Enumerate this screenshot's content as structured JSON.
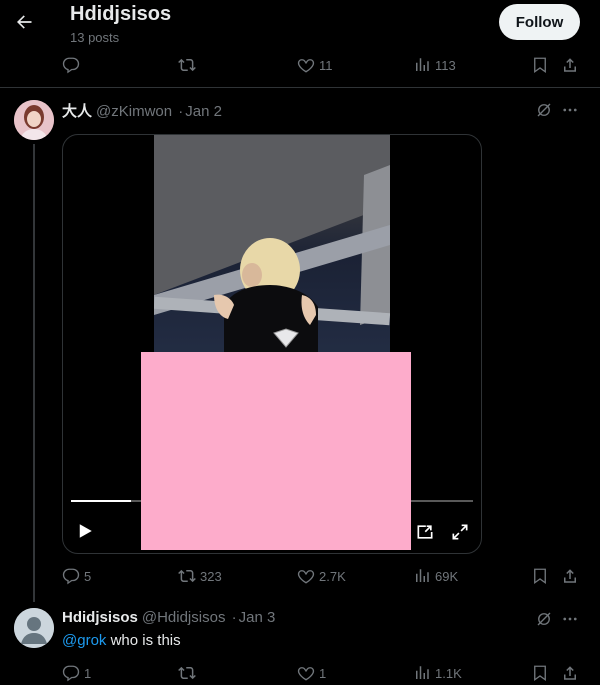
{
  "header": {
    "title": "Hdidjsisos",
    "subtitle": "13 posts",
    "follow_label": "Follow",
    "back_icon": "arrow-left-icon"
  },
  "top_actions": {
    "reply_count": "",
    "retweet_count": "",
    "like_count": "11",
    "views_count": "113"
  },
  "tweet1": {
    "name": "大人",
    "handle": "@zKimwon",
    "dot": "·",
    "date": "Jan 2",
    "media": {
      "type": "video",
      "progress": 0.15,
      "censored": true
    },
    "actions": {
      "reply_count": "5",
      "retweet_count": "323",
      "like_count": "2.7K",
      "views_count": "69K"
    }
  },
  "tweet2": {
    "name": "Hdidjsisos",
    "handle": "@Hdidjsisos",
    "dot": "·",
    "date": "Jan 3",
    "mention": "@grok",
    "text": " who is this",
    "actions": {
      "reply_count": "1",
      "retweet_count": "",
      "like_count": "1",
      "views_count": "1.1K"
    }
  },
  "colors": {
    "background": "#000000",
    "text": "#e7e9ea",
    "muted": "#71767b",
    "accent": "#1d9bf0",
    "divider": "#2f3336",
    "censor": "#fdaccb"
  }
}
